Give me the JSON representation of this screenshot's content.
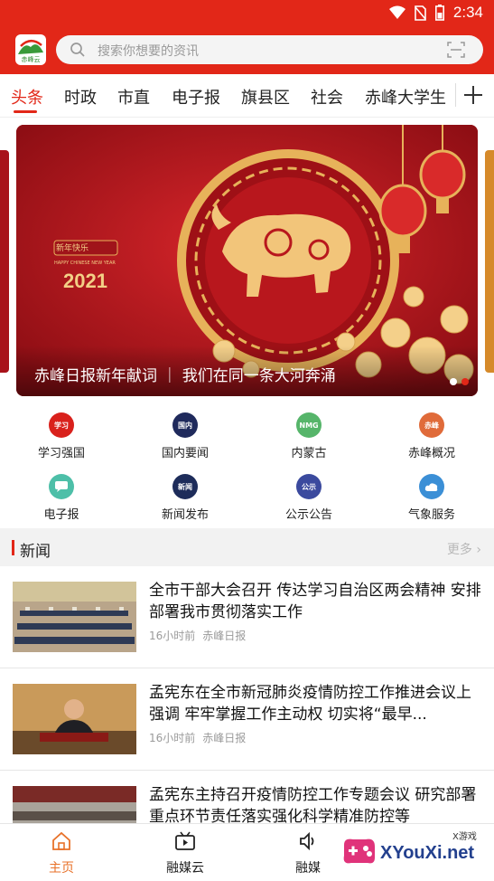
{
  "status": {
    "time": "2:34"
  },
  "header": {
    "logo_text": "赤峰云",
    "search_placeholder": "搜索你想要的资讯"
  },
  "tabs": [
    {
      "label": "头条",
      "active": true
    },
    {
      "label": "时政"
    },
    {
      "label": "市直"
    },
    {
      "label": "电子报"
    },
    {
      "label": "旗县区"
    },
    {
      "label": "社会"
    },
    {
      "label": "赤峰大学生"
    }
  ],
  "banner": {
    "caption": "赤峰日报新年献词 ｜ 我们在同一条大河奔涌",
    "year": "2021",
    "small_text": "HAPPY CHINESE NEW YEAR",
    "seal_text": "新年快乐",
    "slide_count": 2,
    "active_slide": 2
  },
  "quick_links": [
    {
      "label": "学习强国",
      "icon": "xuexi-icon",
      "color": "#d9211c"
    },
    {
      "label": "国内要闻",
      "icon": "domestic-news-icon",
      "color": "#1f2a5c"
    },
    {
      "label": "内蒙古",
      "icon": "inner-mongolia-icon",
      "color": "#56b56a"
    },
    {
      "label": "赤峰概况",
      "icon": "chifeng-overview-icon",
      "color": "#e06b3a"
    },
    {
      "label": "电子报",
      "icon": "e-paper-icon",
      "color": "#4dbfa8"
    },
    {
      "label": "新闻发布",
      "icon": "news-release-icon",
      "color": "#1d2c5a"
    },
    {
      "label": "公示公告",
      "icon": "announcement-icon",
      "color": "#3b4a9e"
    },
    {
      "label": "气象服务",
      "icon": "weather-icon",
      "color": "#3b8fd6"
    }
  ],
  "news": {
    "title": "新闻",
    "more": "更多",
    "items": [
      {
        "title": "全市干部大会召开  传达学习自治区两会精神  安排部署我市贯彻落实工作",
        "time": "16小时前",
        "source": "赤峰日报"
      },
      {
        "title": "孟宪东在全市新冠肺炎疫情防控工作推进会议上强调  牢牢掌握工作主动权  切实将“最早...",
        "time": "16小时前",
        "source": "赤峰日报"
      },
      {
        "title": "孟宪东主持召开疫情防控工作专题会议  研究部署重点环节责任落实强化科学精准防控等",
        "time": "",
        "source": ""
      }
    ]
  },
  "bottom_nav": [
    {
      "label": "主页",
      "icon": "home-icon",
      "active": true
    },
    {
      "label": "融媒云",
      "icon": "video-icon"
    },
    {
      "label": "融媒",
      "icon": "speaker-icon"
    }
  ],
  "watermark": {
    "text": "XYouXi.net",
    "small": "X游戏"
  }
}
